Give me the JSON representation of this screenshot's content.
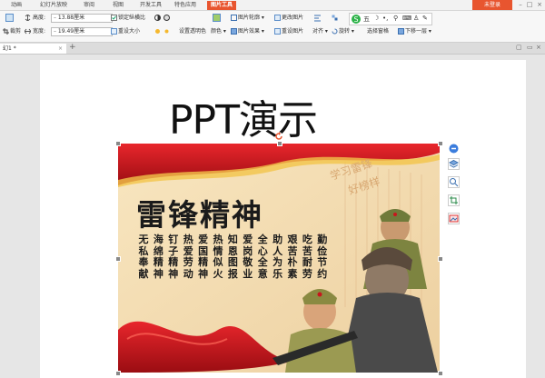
{
  "menu_tabs": [
    "动画",
    "幻灯片放映",
    "审阅",
    "视图",
    "开发工具",
    "特色应用",
    "图片工具"
  ],
  "login_label": "未登录",
  "ribbon": {
    "height_label": "高度:",
    "height_value": "13.88厘米",
    "width_label": "宽度:",
    "width_value": "19.49厘米",
    "lock_ratio": "锁定纵横比",
    "crop": "裁剪",
    "rotate_label": "旋转",
    "reset_size": "重设大小",
    "set_transparent": "设置透明色",
    "color": "颜色",
    "picture_outline": "图片轮廓",
    "picture_effect": "图片效果",
    "change_picture": "更改图片",
    "reset_picture": "重设图片",
    "align": "对齐",
    "rotate": "旋转",
    "selection_pane": "选择窗格",
    "send_backward": "下移一层"
  },
  "doc_tab": "幻1 *",
  "slide": {
    "title": "PPT演示",
    "poster": {
      "heading": "雷锋精神",
      "columns": [
        "无私奉献",
        "海绵精神",
        "钉子精神",
        "热爱劳动",
        "爱国精神",
        "热情似火",
        "知恩图报",
        "爱岗敬业",
        "全心全意",
        "助人为乐",
        "艰苦朴素",
        "吃苦耐劳",
        "勤俭节约"
      ],
      "calligraphy": "学习雷锋好榜样"
    }
  },
  "colors": {
    "accent": "#e8552f",
    "poster_red": "#c8161d",
    "poster_bg": "#f5ddb0"
  }
}
